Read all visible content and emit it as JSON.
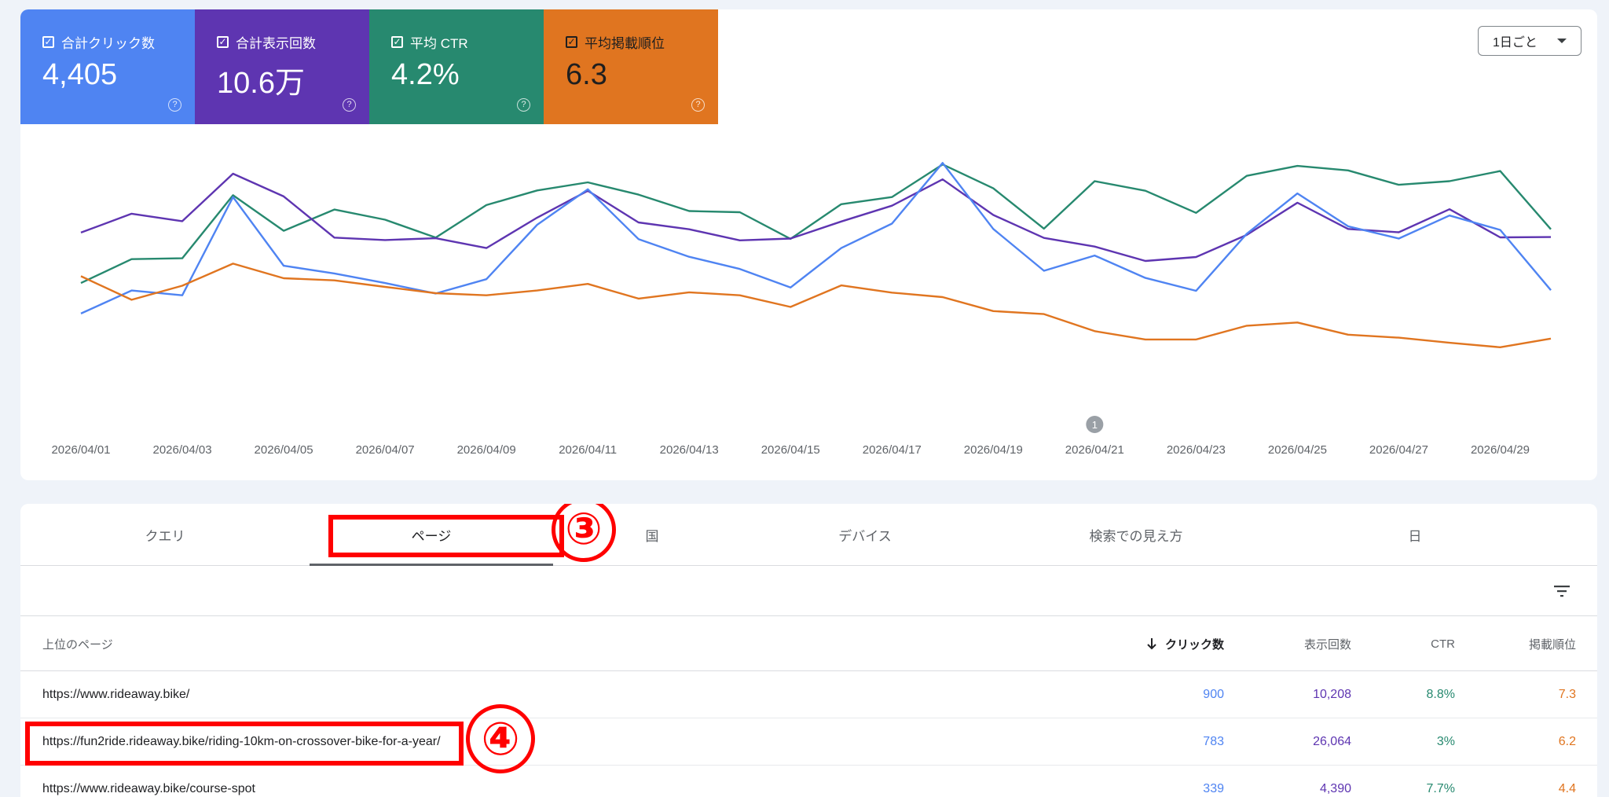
{
  "metrics": [
    {
      "label": "合計クリック数",
      "value": "4,405",
      "color": "#4f84f2"
    },
    {
      "label": "合計表示回数",
      "value": "10.6万",
      "color": "#5e35b1"
    },
    {
      "label": "平均 CTR",
      "value": "4.2%",
      "color": "#27896f"
    },
    {
      "label": "平均掲載順位",
      "value": "6.3",
      "color": "#e07520"
    }
  ],
  "interval_dropdown": {
    "value": "1日ごと"
  },
  "chart_data": {
    "type": "line",
    "x": [
      "2026/04/01",
      "2026/04/02",
      "2026/04/03",
      "2026/04/04",
      "2026/04/05",
      "2026/04/06",
      "2026/04/07",
      "2026/04/08",
      "2026/04/09",
      "2026/04/10",
      "2026/04/11",
      "2026/04/12",
      "2026/04/13",
      "2026/04/14",
      "2026/04/15",
      "2026/04/16",
      "2026/04/17",
      "2026/04/18",
      "2026/04/19",
      "2026/04/20",
      "2026/04/21",
      "2026/04/22",
      "2026/04/23",
      "2026/04/24",
      "2026/04/25",
      "2026/04/26",
      "2026/04/27",
      "2026/04/28",
      "2026/04/29",
      "2026/04/30"
    ],
    "x_tick_labels": [
      "2026/04/01",
      "2026/04/03",
      "2026/04/05",
      "2026/04/07",
      "2026/04/09",
      "2026/04/11",
      "2026/04/13",
      "2026/04/15",
      "2026/04/17",
      "2026/04/19",
      "2026/04/21",
      "2026/04/23",
      "2026/04/25",
      "2026/04/27",
      "2026/04/29"
    ],
    "normalized_scale": [
      0,
      1
    ],
    "series": [
      {
        "color": "#27896f",
        "values": [
          0.505,
          0.585,
          0.588,
          0.799,
          0.68,
          0.751,
          0.717,
          0.657,
          0.766,
          0.815,
          0.842,
          0.801,
          0.746,
          0.742,
          0.653,
          0.769,
          0.793,
          0.902,
          0.822,
          0.687,
          0.846,
          0.814,
          0.74,
          0.864,
          0.897,
          0.882,
          0.834,
          0.846,
          0.88,
          0.685
        ]
      },
      {
        "color": "#5e35b1",
        "values": [
          0.674,
          0.737,
          0.712,
          0.871,
          0.795,
          0.657,
          0.649,
          0.655,
          0.622,
          0.724,
          0.814,
          0.708,
          0.685,
          0.648,
          0.654,
          0.711,
          0.764,
          0.852,
          0.733,
          0.656,
          0.627,
          0.579,
          0.592,
          0.666,
          0.774,
          0.686,
          0.675,
          0.752,
          0.658,
          0.659
        ]
      },
      {
        "color": "#4f84f2",
        "values": [
          0.403,
          0.48,
          0.464,
          0.793,
          0.563,
          0.537,
          0.505,
          0.47,
          0.518,
          0.7,
          0.819,
          0.652,
          0.593,
          0.552,
          0.49,
          0.622,
          0.704,
          0.907,
          0.686,
          0.546,
          0.597,
          0.522,
          0.479,
          0.67,
          0.805,
          0.695,
          0.654,
          0.731,
          0.683,
          0.481
        ]
      },
      {
        "color": "#e07520",
        "values": [
          0.528,
          0.449,
          0.496,
          0.57,
          0.521,
          0.514,
          0.492,
          0.471,
          0.464,
          0.48,
          0.502,
          0.453,
          0.474,
          0.464,
          0.425,
          0.497,
          0.473,
          0.458,
          0.411,
          0.401,
          0.344,
          0.316,
          0.316,
          0.362,
          0.373,
          0.332,
          0.322,
          0.305,
          0.29,
          0.319
        ]
      }
    ],
    "annotations": [
      {
        "x": "2026/04/21",
        "label": "1"
      }
    ]
  },
  "tabs": [
    {
      "label": "クエリ"
    },
    {
      "label": "ページ",
      "active": true
    },
    {
      "label": "国"
    },
    {
      "label": "デバイス"
    },
    {
      "label": "検索での見え方"
    },
    {
      "label": "日"
    }
  ],
  "annotations": {
    "tab_marker": "③",
    "row_marker": "④"
  },
  "table": {
    "headers": {
      "page": "上位のページ",
      "clicks": "クリック数",
      "impressions": "表示回数",
      "ctr": "CTR",
      "position": "掲載順位"
    },
    "rows": [
      {
        "url": "https://www.rideaway.bike/",
        "clicks": "900",
        "impressions": "10,208",
        "ctr": "8.8%",
        "position": "7.3"
      },
      {
        "url": "https://fun2ride.rideaway.bike/riding-10km-on-crossover-bike-for-a-year/",
        "clicks": "783",
        "impressions": "26,064",
        "ctr": "3%",
        "position": "6.2"
      },
      {
        "url": "https://www.rideaway.bike/course-spot",
        "clicks": "339",
        "impressions": "4,390",
        "ctr": "7.7%",
        "position": "4.4"
      }
    ]
  }
}
